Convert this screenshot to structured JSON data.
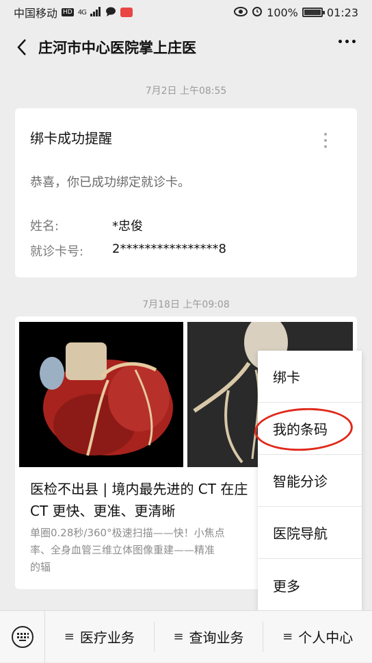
{
  "status_bar": {
    "carrier": "中国移动",
    "hd_badge": "HD",
    "network": "4G",
    "battery": "100%",
    "time": "01:23"
  },
  "header": {
    "title": "庄河市中心医院掌上庄医"
  },
  "messages": [
    {
      "timestamp": "7月2日 上午08:55",
      "title": "绑卡成功提醒",
      "body": "恭喜，你已成功绑定就诊卡。",
      "fields": [
        {
          "label": "姓名:",
          "value": "*忠俊"
        },
        {
          "label": "就诊卡号:",
          "value": "2****************8"
        }
      ]
    },
    {
      "timestamp": "7月18日 上午09:08",
      "article_title": "医检不出县 | 境内最先进的 CT 在庄 CT 更快、更准、更清晰",
      "article_title_line1": "医检不出县 | 境内最先进的 CT 在庄",
      "article_title_line2": "CT 更快、更准、更清晰",
      "article_desc_line1": "单圈0.28秒/360°极速扫描——快！小焦点",
      "article_desc_line2": "率、全身血管三维立体图像重建——精准",
      "article_desc_line3": "的辐"
    }
  ],
  "popup_menu": {
    "items": [
      "绑卡",
      "我的条码",
      "智能分诊",
      "医院导航",
      "更多"
    ],
    "highlighted": "我的条码",
    "highlight_color": "#e0291b"
  },
  "bottom_bar": {
    "tabs": [
      {
        "mark": "≡",
        "label": "医疗业务"
      },
      {
        "mark": "≡",
        "label": "查询业务"
      },
      {
        "mark": "≡",
        "label": "个人中心"
      }
    ]
  }
}
